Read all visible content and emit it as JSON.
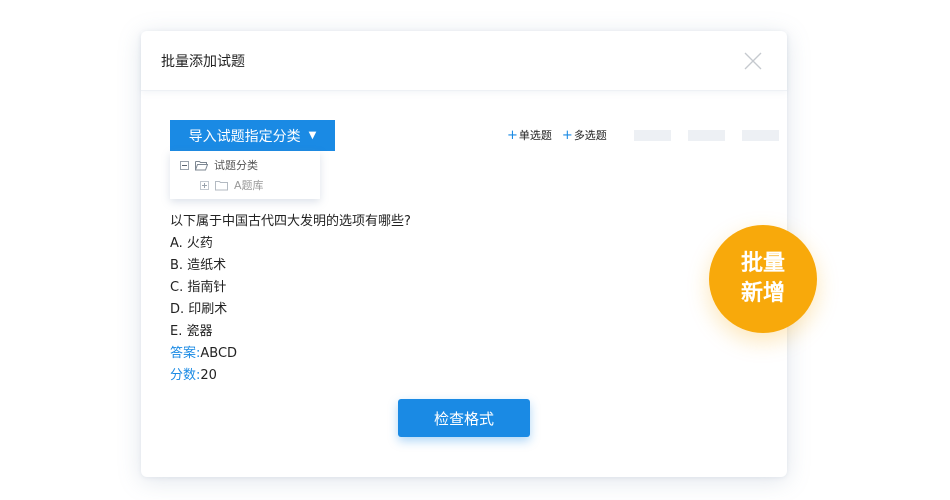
{
  "modal": {
    "title": "批量添加试题",
    "close_icon": "close-icon"
  },
  "import": {
    "label": "导入试题指定分类",
    "caret": "▼"
  },
  "tree": {
    "items": [
      {
        "label": "试题分类",
        "icon": "folder-open-icon",
        "toggle": "collapse-icon"
      },
      {
        "label": "A题库",
        "icon": "folder-icon",
        "toggle": "expand-icon"
      }
    ]
  },
  "toolbar": {
    "single_choice": "单选题",
    "multiple_choice": "多选题",
    "plus": "+"
  },
  "question": {
    "stem": "以下属于中国古代四大发明的选项有哪些?",
    "options": [
      "A. 火药",
      "B. 造纸术",
      "C. 指南针",
      "D. 印刷术",
      "E. 瓷器"
    ],
    "answer_label": "答案:",
    "answer_value": "ABCD",
    "score_label": "分数:",
    "score_value": "20"
  },
  "check_button": {
    "label": "检查格式"
  },
  "badge": {
    "line1": "批量",
    "line2": "新增"
  },
  "colors": {
    "accent": "#1a8ae4",
    "badge": "#f8a90b"
  }
}
